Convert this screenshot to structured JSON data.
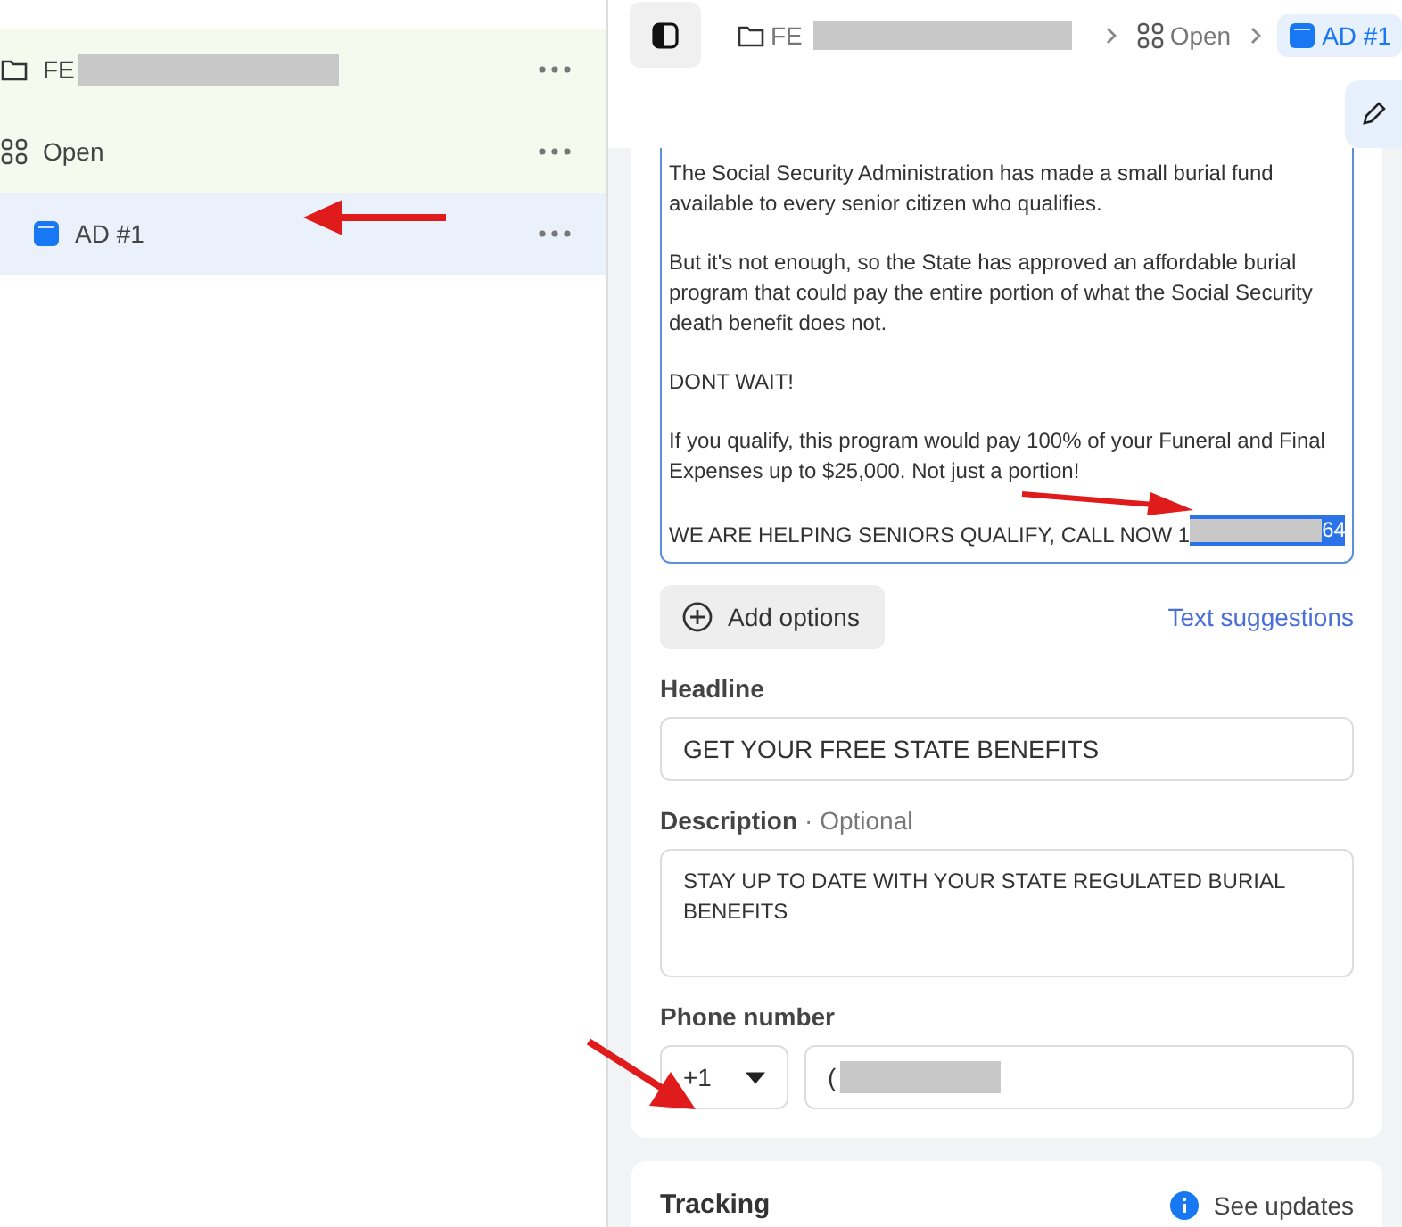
{
  "sidebar": {
    "items": [
      {
        "label": "FE",
        "kind": "folder",
        "redacted": true,
        "selected": false,
        "children": [
          {
            "label": "Open",
            "kind": "group",
            "redacted": false,
            "selected": false,
            "children": [
              {
                "label": "AD #1",
                "kind": "ad",
                "redacted": false,
                "selected": true
              }
            ]
          }
        ]
      }
    ]
  },
  "breadcrumb": [
    {
      "label": "FE",
      "kind": "folder",
      "redacted": true,
      "selected": false
    },
    {
      "label": "Open",
      "kind": "group",
      "redacted": false,
      "selected": false
    },
    {
      "label": "AD #1",
      "kind": "ad",
      "redacted": false,
      "selected": true
    }
  ],
  "primary_text": {
    "paragraphs": [
      "The Social Security Administration has made a small burial fund available to every senior citizen who qualifies.",
      "But it's not enough, so the State has approved an affordable burial program that could pay the entire portion of what the Social Security death benefit does not.",
      "DONT WAIT!",
      "If you qualify, this program would pay 100% of your Funeral and Final Expenses up to $25,000. Not just a portion!"
    ],
    "last_line": "WE ARE HELPING SENIORS QUALIFY, CALL NOW 1",
    "selected_tail": "64"
  },
  "add_options_button": "Add options",
  "text_suggestions_link": "Text suggestions",
  "headline": {
    "label": "Headline",
    "value": "GET YOUR FREE STATE BENEFITS"
  },
  "description": {
    "label": "Description",
    "optional": "· Optional",
    "value": "STAY UP TO DATE WITH YOUR STATE REGULATED BURIAL BENEFITS"
  },
  "phone": {
    "label": "Phone number",
    "country_code": "+1",
    "value": "(",
    "redacted": true
  },
  "tracking": {
    "title": "Tracking",
    "link": "See updates"
  }
}
